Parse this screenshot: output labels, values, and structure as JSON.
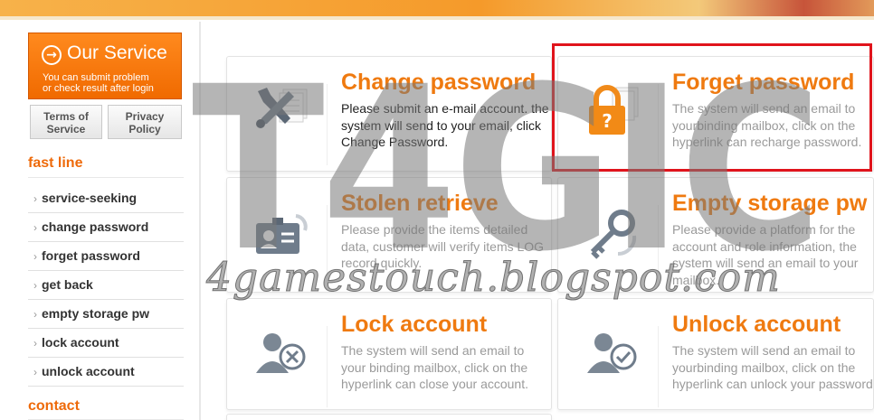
{
  "sidebar": {
    "service": {
      "title": "Our Service",
      "subtitle_line1": "You can submit problem",
      "subtitle_line2": "or check result after login"
    },
    "terms": {
      "line1": "Terms of",
      "line2": "Service"
    },
    "privacy": {
      "line1": "Privacy",
      "line2": "Policy"
    },
    "fast_line_title": "fast line",
    "fast_items": [
      "service-seeking",
      "change password",
      "forget password",
      "get back",
      "empty storage pw",
      "lock account",
      "unlock account"
    ],
    "contact_title": "contact"
  },
  "cards": [
    {
      "title": "Change password",
      "desc": "Please submit an e-mail account. the system will send to your email, click Change Password.",
      "icon": "tools-icon"
    },
    {
      "title": "Forget password",
      "desc": "The system will send an email to yourbinding mailbox, click on the hyperlink can recharge password.",
      "icon": "padlock-question-icon"
    },
    {
      "title": "Stolen retrieve",
      "desc": "Please provide the items detailed data, customer will verify items LOG record quickly.",
      "icon": "id-card-icon"
    },
    {
      "title": "Empty storage pw",
      "desc": "Please provide a platform for the account and role information, the system will send an email to your mailbox.",
      "icon": "key-icon"
    },
    {
      "title": "Lock account",
      "desc": "The system will send an email to your binding mailbox, click on the hyperlink can close your account.",
      "icon": "user-lock-icon"
    },
    {
      "title": "Unlock account",
      "desc": "The system will send an email to yourbinding mailbox, click on the hyperlink can unlock your password",
      "icon": "user-check-icon"
    }
  ],
  "watermark": {
    "main": "T4GIC",
    "sub": "4gamestouch.blogspot.com"
  },
  "colors": {
    "accent": "#ef7a10",
    "highlight": "#e0141c"
  }
}
